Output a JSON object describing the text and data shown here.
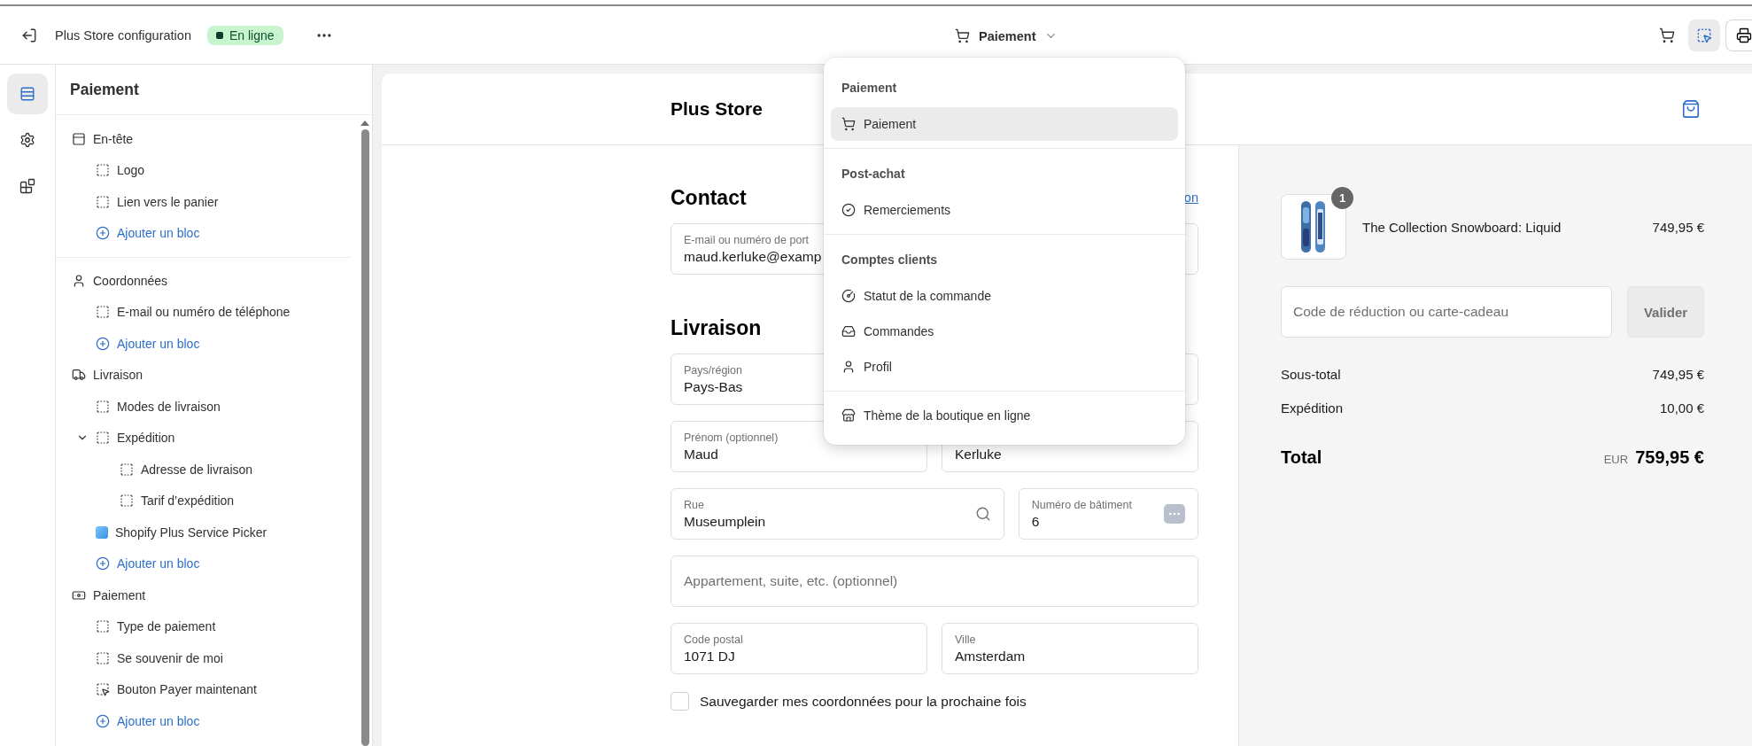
{
  "topbar": {
    "title": "Plus Store configuration",
    "status": "En ligne",
    "page": "Paiement"
  },
  "toolbar": [
    {
      "selected": false
    },
    {
      "selected": true
    },
    {
      "selected": false
    }
  ],
  "rail": [
    {
      "selected": true
    },
    {
      "selected": false
    },
    {
      "selected": false
    }
  ],
  "sidebar": {
    "title": "Paiement",
    "sections": [
      {
        "label": "En-tête",
        "children": [
          {
            "kind": "block",
            "label": "Logo"
          },
          {
            "kind": "block",
            "label": "Lien vers le panier"
          },
          {
            "kind": "add",
            "label": "Ajouter un bloc"
          }
        ]
      },
      {
        "label": "Coordonnées",
        "children": [
          {
            "kind": "block",
            "label": "E-mail ou numéro de téléphone"
          },
          {
            "kind": "add",
            "label": "Ajouter un bloc"
          }
        ]
      },
      {
        "label": "Livraison",
        "children": [
          {
            "kind": "block",
            "label": "Modes de livraison"
          },
          {
            "kind": "block",
            "label": "Expédition",
            "expanded": true,
            "children": [
              {
                "kind": "block",
                "label": "Adresse de livraison"
              },
              {
                "kind": "block",
                "label": "Tarif d’expédition"
              }
            ]
          },
          {
            "kind": "app",
            "label": "Shopify Plus Service Picker"
          },
          {
            "kind": "add",
            "label": "Ajouter un bloc"
          }
        ]
      },
      {
        "label": "Paiement",
        "children": [
          {
            "kind": "block",
            "label": "Type de paiement"
          },
          {
            "kind": "block",
            "label": "Se souvenir de moi"
          },
          {
            "kind": "pointer",
            "label": "Bouton Payer maintenant"
          },
          {
            "kind": "add",
            "label": "Ajouter un bloc"
          }
        ]
      }
    ]
  },
  "menu": {
    "groups": [
      {
        "title": "Paiement",
        "items": [
          {
            "label": "Paiement",
            "selected": true
          }
        ]
      },
      {
        "title": "Post-achat",
        "items": [
          {
            "label": "Remerciements",
            "selected": false
          }
        ]
      },
      {
        "title": "Comptes clients",
        "items": [
          {
            "label": "Statut de la commande",
            "selected": false
          },
          {
            "label": "Commandes",
            "selected": false
          },
          {
            "label": "Profil",
            "selected": false
          }
        ]
      },
      {
        "items": [
          {
            "label": "Thème de la boutique en ligne",
            "selected": false
          }
        ]
      }
    ]
  },
  "preview": {
    "store_name": "Plus Store",
    "form": {
      "sections": [
        {
          "heading": "Contact",
          "link": "on",
          "rows": [
            [
              {
                "label": "E-mail ou numéro de port",
                "value": "maud.kerluke@examp"
              }
            ]
          ]
        },
        {
          "heading": "Livraison",
          "rows": [
            [
              {
                "label": "Pays/région",
                "value": "Pays-Bas"
              }
            ],
            [
              {
                "label": "Prénom (optionnel)",
                "value": "Maud"
              },
              {
                "value": "Kerluke"
              }
            ],
            [
              {
                "label": "Rue",
                "value": "Museumplein",
                "kind": "search"
              },
              {
                "label": "Numéro de bâtiment",
                "value": "6",
                "kind": "suggest"
              }
            ],
            [
              {
                "placeholder": "Appartement, suite, etc. (optionnel)"
              }
            ],
            [
              {
                "label": "Code postal",
                "value": "1071 DJ"
              },
              {
                "label": "Ville",
                "value": "Amsterdam"
              }
            ]
          ]
        }
      ],
      "save_info": {
        "label": "Sauvegarder mes coordonnées pour la prochaine fois",
        "checked": false
      }
    },
    "summary": {
      "items": [
        {
          "name": "The Collection Snowboard: Liquid",
          "price": "749,95 €",
          "quantity": "1"
        }
      ],
      "discount": {
        "placeholder": "Code de réduction ou carte-cadeau",
        "button": "Valider"
      },
      "lines": [
        {
          "label": "Sous-total",
          "value": "749,95 €"
        },
        {
          "label": "Expédition",
          "value": "10,00 €"
        }
      ],
      "total": {
        "label": "Total",
        "currency": "EUR",
        "value": "759,95 €"
      }
    }
  }
}
